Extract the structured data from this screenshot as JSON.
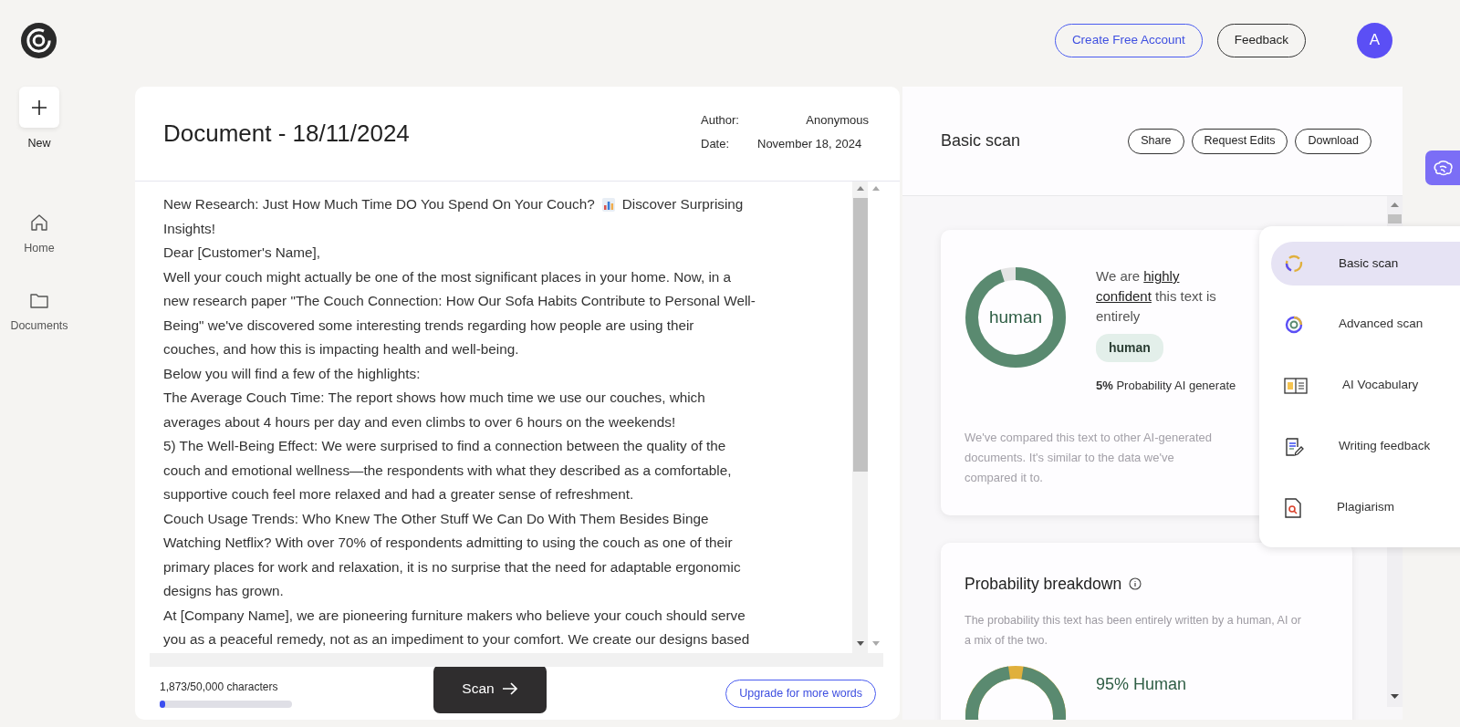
{
  "header": {
    "buttons": [
      {
        "label": "Create Free Account",
        "kind": "outline-blue"
      },
      {
        "label": "Feedback",
        "kind": "outline-dark"
      }
    ],
    "avatar": "A"
  },
  "sidebar": {
    "new_label": "New",
    "items": [
      {
        "label": "Home"
      },
      {
        "label": "Documents"
      }
    ]
  },
  "document": {
    "title": "Document - 18/11/2024",
    "meta": [
      {
        "label": "Author:",
        "value": "Anonymous"
      },
      {
        "label": "Date:",
        "value": "November 18, 2024"
      }
    ],
    "lines": [
      {
        "text": "New Research: Just How Much Time DO You Spend On Your Couch?",
        "after": "Discover Surprising"
      },
      {
        "text": "Insights!"
      },
      {
        "text": "Dear [Customer's Name],"
      },
      {
        "text": "Well your couch might actually be one of the most significant places in your home. Now, in a"
      },
      {
        "text": "new research paper \"The Couch Connection: How Our Sofa Habits Contribute to Personal Well-"
      },
      {
        "text": "Being\" we've discovered some interesting trends regarding how people are using their"
      },
      {
        "text": "couches, and how this is impacting health and well-being."
      },
      {
        "text": "Below you will find a few of the highlights:"
      },
      {
        "text": "The Average Couch Time: The report shows how much time we use our couches, which"
      },
      {
        "text": "averages about 4 hours per day and even climbs to over 6 hours on the weekends!"
      },
      {
        "text": "5) The Well-Being Effect: We were surprised to find a connection between the quality of the"
      },
      {
        "text": "couch and emotional wellness—the respondents with what they described as a comfortable,"
      },
      {
        "text": "supportive couch feel more relaxed and had a greater sense of refreshment."
      },
      {
        "text": "Couch Usage Trends: Who Knew The Other Stuff We Can Do With Them Besides Binge"
      },
      {
        "text": "Watching Netflix? With over 70% of respondents admitting to using the couch as one of their"
      },
      {
        "text": "primary places for work and relaxation, it is no surprise that the need for adaptable ergonomic"
      },
      {
        "text": "designs has grown."
      },
      {
        "text": "At [Company Name], we are pioneering furniture makers who believe your couch should serve"
      },
      {
        "text": "you as a peaceful remedy, not as an impediment to your comfort. We create our designs based"
      }
    ],
    "char_count": "1,873/50,000 characters",
    "char_progress": {
      "level": 0.04
    },
    "scan_button": "Scan",
    "upgrade_button": "Upgrade for more words"
  },
  "scan": {
    "title": "Basic scan",
    "actions": [
      "Share",
      "Request Edits",
      "Download"
    ],
    "result": {
      "donut_label": "human",
      "sentence": "We are **highly confident** this text is entirely",
      "verdict": "human",
      "ai_percent": "5%",
      "ai_text": "Probability AI generate",
      "note": "We've compared this text to other AI-generated documents. It's similar to the data we've compared it to."
    },
    "breakdown": {
      "title": "Probability breakdown",
      "description": "The probability this text has been entirely written by a human, AI or a mix of the two.",
      "human_label": "95% Human"
    }
  },
  "menu": [
    {
      "label": "Basic scan",
      "selected": true
    },
    {
      "label": "Advanced scan",
      "selected": false
    },
    {
      "label": "AI Vocabulary",
      "selected": false
    },
    {
      "label": "Writing feedback",
      "selected": false
    },
    {
      "label": "Plagiarism",
      "selected": false
    }
  ]
}
